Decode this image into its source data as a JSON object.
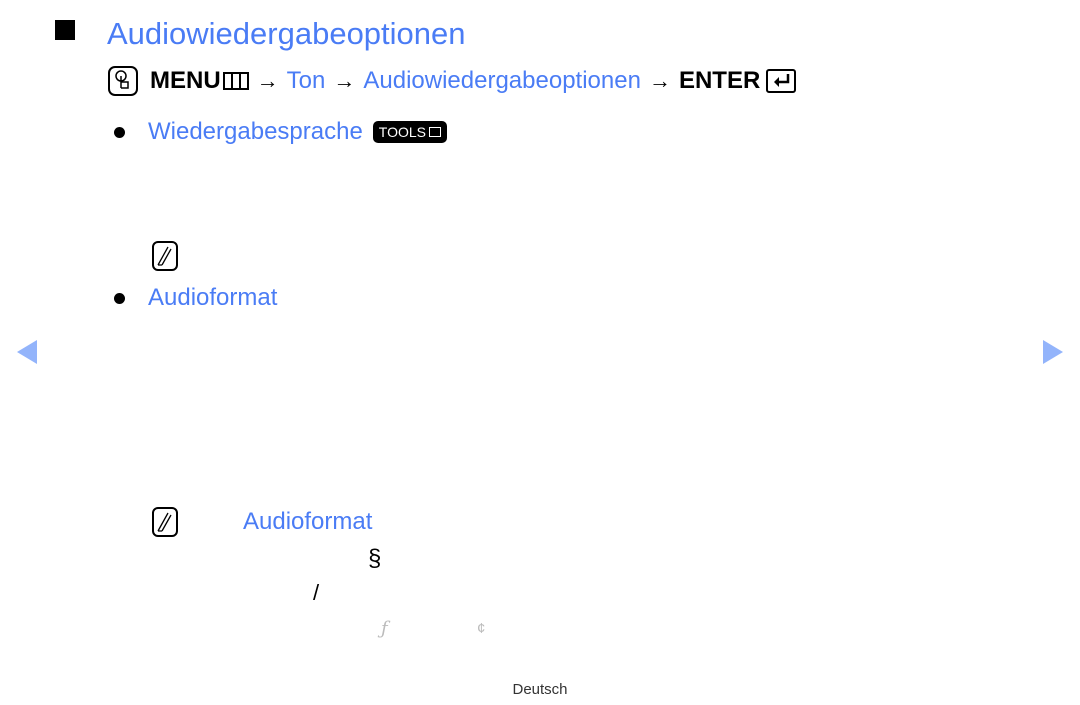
{
  "header": {
    "title": "Audiowiedergabeoptionen",
    "title_icon": "square-bullet-icon"
  },
  "menu_path": {
    "menu_icon": "hand-pointer-icon",
    "menu_label": "MENU",
    "menu_grid_icon": "menu-grid-icon",
    "arrow": "→",
    "steps": [
      "Ton",
      "Audiowiedergabeoptionen"
    ],
    "enter_label": "ENTER",
    "enter_icon": "enter-icon"
  },
  "sections": [
    {
      "heading": "Wiedergabesprache",
      "badge": "TOOLS",
      "badge_icon": "tools-icon",
      "note_icon": "note-icon"
    },
    {
      "heading": "Audioformat"
    }
  ],
  "note": {
    "icon": "note-icon",
    "label": "Audioformat",
    "glyphs": [
      "§",
      "/",
      "ƒ",
      "¢"
    ]
  },
  "navigation": {
    "prev_icon": "triangle-left-icon",
    "next_icon": "triangle-right-icon",
    "color": "#93b4fb"
  },
  "footer": {
    "language": "Deutsch"
  },
  "colors": {
    "accent": "#4a7cf5",
    "text": "#000000"
  }
}
